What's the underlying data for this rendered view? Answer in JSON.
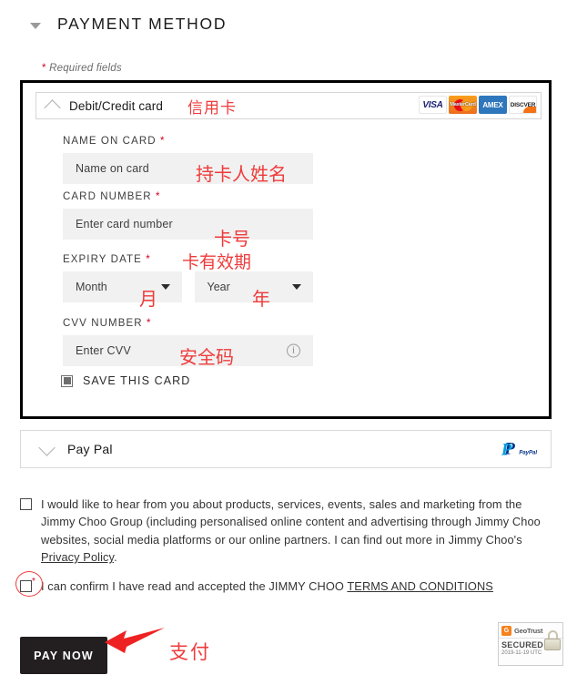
{
  "section": {
    "title": "PAYMENT METHOD",
    "collapse_icon": "caret-down-icon",
    "required_note": "Required fields",
    "required_star": "*"
  },
  "card_method": {
    "label": "Debit/Credit card",
    "annotation_cn": "信用卡",
    "chevron_icon": "chevron-up-icon",
    "brands": [
      {
        "name": "VISA",
        "key": "visa-logo"
      },
      {
        "name": "MasterCard",
        "key": "mastercard-logo"
      },
      {
        "name": "AMEX",
        "key": "amex-logo"
      },
      {
        "name": "DISCOVER",
        "key": "discover-logo"
      }
    ],
    "fields": {
      "name_on_card": {
        "label": "NAME ON CARD",
        "required": "*",
        "placeholder": "Name on card",
        "value": "",
        "annotation_cn": "持卡人姓名"
      },
      "card_number": {
        "label": "CARD NUMBER",
        "required": "*",
        "placeholder": "Enter card number",
        "value": "",
        "annotation_cn": "卡号"
      },
      "expiry": {
        "label": "EXPIRY DATE",
        "required": "*",
        "annotation_cn": "卡有效期",
        "month": {
          "selected": "Month",
          "annotation_cn": "月"
        },
        "year": {
          "selected": "Year",
          "annotation_cn": "年"
        }
      },
      "cvv": {
        "label": "CVV NUMBER",
        "required": "*",
        "placeholder": "Enter CVV",
        "value": "",
        "annotation_cn": "安全码",
        "info_icon": "info-circle-icon",
        "info_glyph": "i"
      }
    },
    "save_card": {
      "label": "SAVE THIS CARD",
      "checked": true
    }
  },
  "paypal_method": {
    "label": "Pay Pal",
    "chevron_icon": "chevron-down-icon",
    "logo_letter": "P",
    "logo_name": "PayPal"
  },
  "consents": {
    "marketing": {
      "checked": false,
      "text_before": "I would like to hear from you about products, services, events, sales and marketing from the Jimmy Choo Group (including personalised online content and advertising through Jimmy Choo websites, social media platforms or our online partners. I can find out more in Jimmy Choo's ",
      "link": "Privacy Policy",
      "text_after": "."
    },
    "terms": {
      "checked": false,
      "required_star": "*",
      "text_before": "I can confirm I have read and accepted the JIMMY CHOO ",
      "link": "TERMS AND CONDITIONS",
      "text_after": ""
    }
  },
  "pay": {
    "button_label": "PAY NOW",
    "annotation_cn": "支付",
    "arrow_icon": "red-arrow-left-icon"
  },
  "trust_badge": {
    "brand": "GeoTrust",
    "status": "SECURED",
    "timestamp": "2019-11-19 UTC",
    "lock_icon": "padlock-icon",
    "mark": "G"
  },
  "colors": {
    "annotation_red": "#ef3b3b",
    "required_red": "#d0021b",
    "button_black": "#231f20",
    "field_gray": "#f1f1f1"
  }
}
